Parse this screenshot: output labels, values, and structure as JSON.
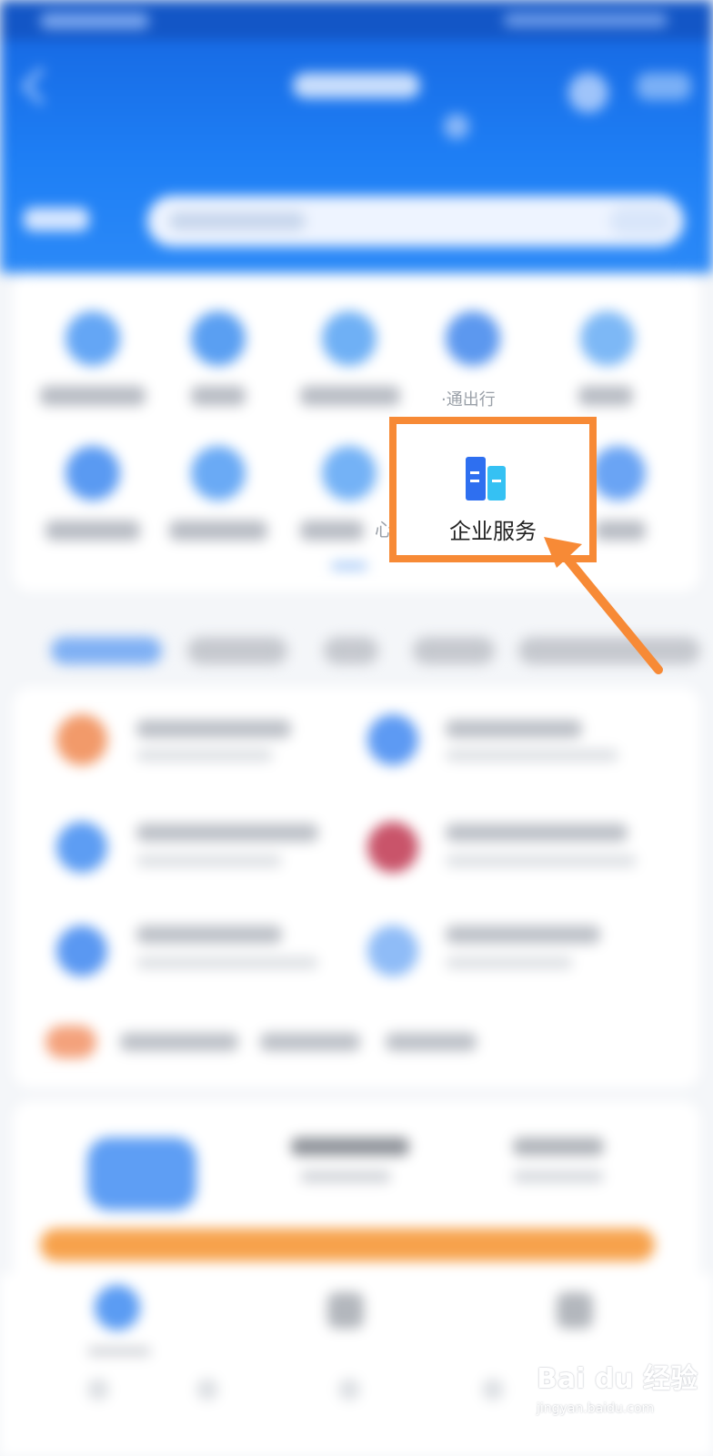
{
  "grid": {
    "highlighted_item": {
      "label": "企业服务",
      "icon": "enterprise-building-icon"
    },
    "partial_labels": {
      "row1_item4": "·通出行",
      "row2_item3": "心"
    }
  },
  "annotation": {
    "highlight_color": "#f78a36",
    "arrow_color": "#f78a36"
  },
  "watermark": {
    "logo": "Bai du 经验",
    "url": "jingyan.baidu.com"
  },
  "colors": {
    "header_blue": "#1e7ff5",
    "accent_orange": "#f7a24c"
  }
}
